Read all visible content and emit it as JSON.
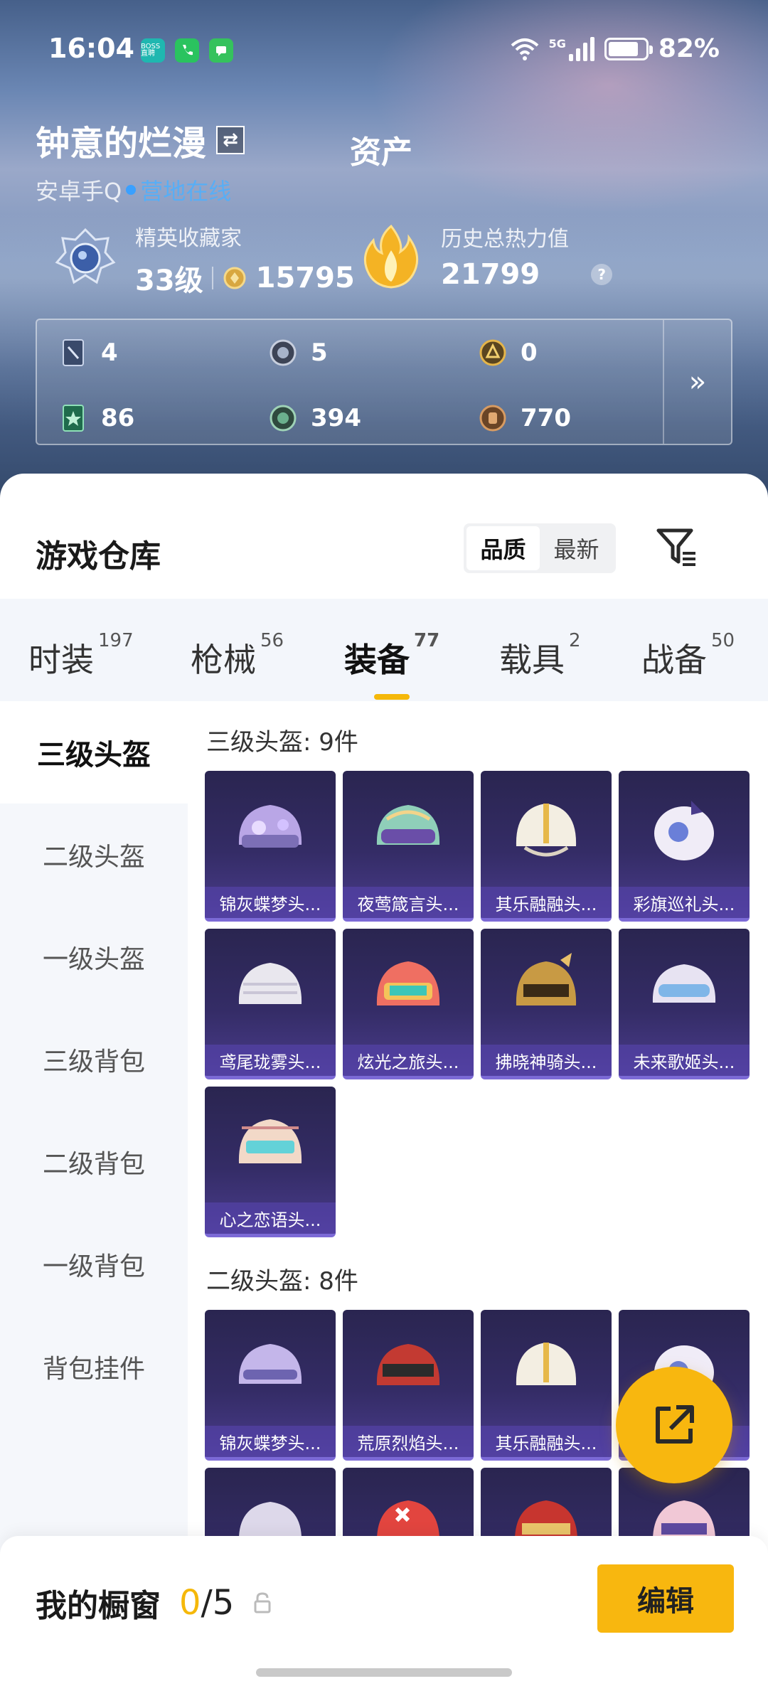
{
  "status_bar": {
    "time": "16:04",
    "app_icons": [
      {
        "name": "boss-icon",
        "label": "BOSS直聘",
        "color": "#1fb7b0"
      },
      {
        "name": "phone-icon",
        "label": "",
        "color": "#2ac35f"
      },
      {
        "name": "message-icon",
        "label": "",
        "color": "#35c25d"
      }
    ],
    "network": "5G",
    "battery": "82%"
  },
  "profile": {
    "name": "钟意的烂漫",
    "switch_icon": "swap-icon",
    "platform": "安卓手Q",
    "online_status": "营地在线",
    "assets_label": "资产",
    "rank_title": "精英收藏家",
    "level": "33级",
    "points": "15795",
    "heat_label": "历史总热力值",
    "heat_value": "21799",
    "help_mark": "?"
  },
  "currencies": [
    {
      "icon": "card-icon",
      "value": "4"
    },
    {
      "icon": "silver-coin-icon",
      "value": "5"
    },
    {
      "icon": "gold-emblem-icon",
      "value": "0"
    },
    {
      "icon": "green-card-icon",
      "value": "86"
    },
    {
      "icon": "green-coin-icon",
      "value": "394"
    },
    {
      "icon": "bronze-coin-icon",
      "value": "770"
    }
  ],
  "more_label": "»",
  "warehouse": {
    "title": "游戏仓库",
    "sort_options": [
      "品质",
      "最新"
    ],
    "selected_sort": "品质"
  },
  "tabs": [
    {
      "label": "时装",
      "count": "197"
    },
    {
      "label": "枪械",
      "count": "56"
    },
    {
      "label": "装备",
      "count": "77"
    },
    {
      "label": "载具",
      "count": "2"
    },
    {
      "label": "战备",
      "count": "50"
    }
  ],
  "active_tab": "装备",
  "sidebar": {
    "items": [
      "三级头盔",
      "二级头盔",
      "一级头盔",
      "三级背包",
      "二级背包",
      "一级背包",
      "背包挂件"
    ],
    "active": "三级头盔"
  },
  "sections": [
    {
      "title": "三级头盔: 9件",
      "items": [
        "锦灰蝶梦头...",
        "夜莺箴言头...",
        "其乐融融头...",
        "彩旗巡礼头...",
        "鸢尾珑雾头...",
        "炫光之旅头...",
        "拂晓神骑头...",
        "未来歌姬头...",
        "心之恋语头..."
      ]
    },
    {
      "title": "二级头盔: 8件",
      "items": [
        "锦灰蝶梦头...",
        "荒原烈焰头...",
        "其乐融融头...",
        "",
        "",
        "",
        "",
        ""
      ]
    }
  ],
  "showcase": {
    "label": "我的橱窗",
    "count_used": "0",
    "count_total": "/5",
    "edit_label": "编辑"
  },
  "colors": {
    "accent": "#f8b70f",
    "online_blue": "#58aef5",
    "card_purple": "#342c66"
  }
}
